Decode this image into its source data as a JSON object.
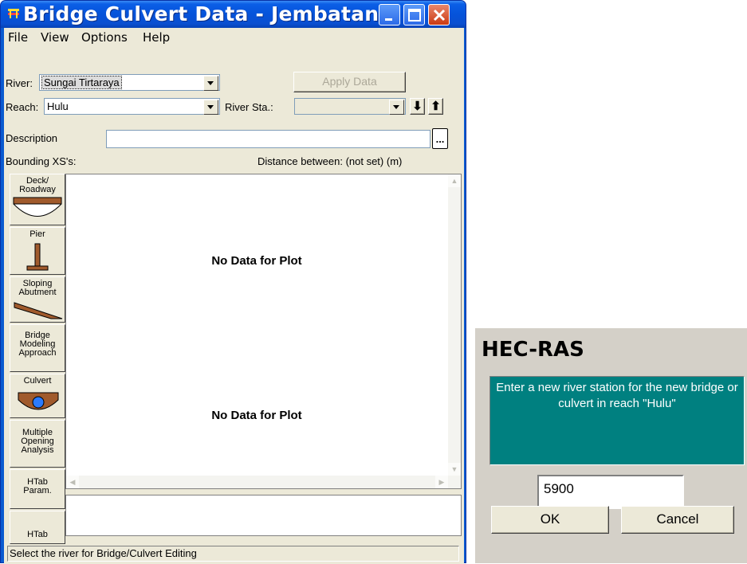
{
  "main_window": {
    "title": "Bridge Culvert Data - Jembatan",
    "menu": [
      "File",
      "View",
      "Options",
      "Help"
    ],
    "river_label": "River:",
    "river_value": "Sungai Tirtaraya",
    "apply_label": "Apply Data",
    "reach_label": "Reach:",
    "reach_value": "Hulu",
    "river_sta_label": "River Sta.:",
    "river_sta_value": "",
    "down_arrow": "⬇",
    "up_arrow": "⬆",
    "description_label": "Description",
    "description_value": "",
    "ellipsis_label": "...",
    "bounding_label": "Bounding XS's:",
    "distance_label": "Distance between: (not set) (m)",
    "toolbar": [
      {
        "label": "Deck/\nRoadway",
        "icon": "deck-icon"
      },
      {
        "label": "Pier",
        "icon": "pier-icon"
      },
      {
        "label": "Sloping\nAbutment",
        "icon": "abutment-icon"
      },
      {
        "label": "Bridge\nModeling\nApproach",
        "icon": ""
      },
      {
        "label": "Culvert",
        "icon": "culvert-icon"
      },
      {
        "label": "Multiple\nOpening\nAnalysis",
        "icon": ""
      },
      {
        "label": "HTab\nParam.",
        "icon": ""
      },
      {
        "label": "HTab",
        "icon": ""
      }
    ],
    "plot_top_text": "No Data for Plot",
    "plot_bottom_text": "No Data for Plot",
    "status_text": "Select the river for Bridge/Culvert Editing"
  },
  "dialog": {
    "title": "HEC-RAS",
    "message": "Enter a new river station for the new bridge or culvert in reach \"Hulu\"",
    "input_value": "5900",
    "ok_label": "OK",
    "cancel_label": "Cancel"
  },
  "colors": {
    "titlebar": "#0553da",
    "close_button": "#cb3a12",
    "window_face": "#ece9d8",
    "dialog_face": "#d4d0c8",
    "message_bg": "#008080"
  }
}
